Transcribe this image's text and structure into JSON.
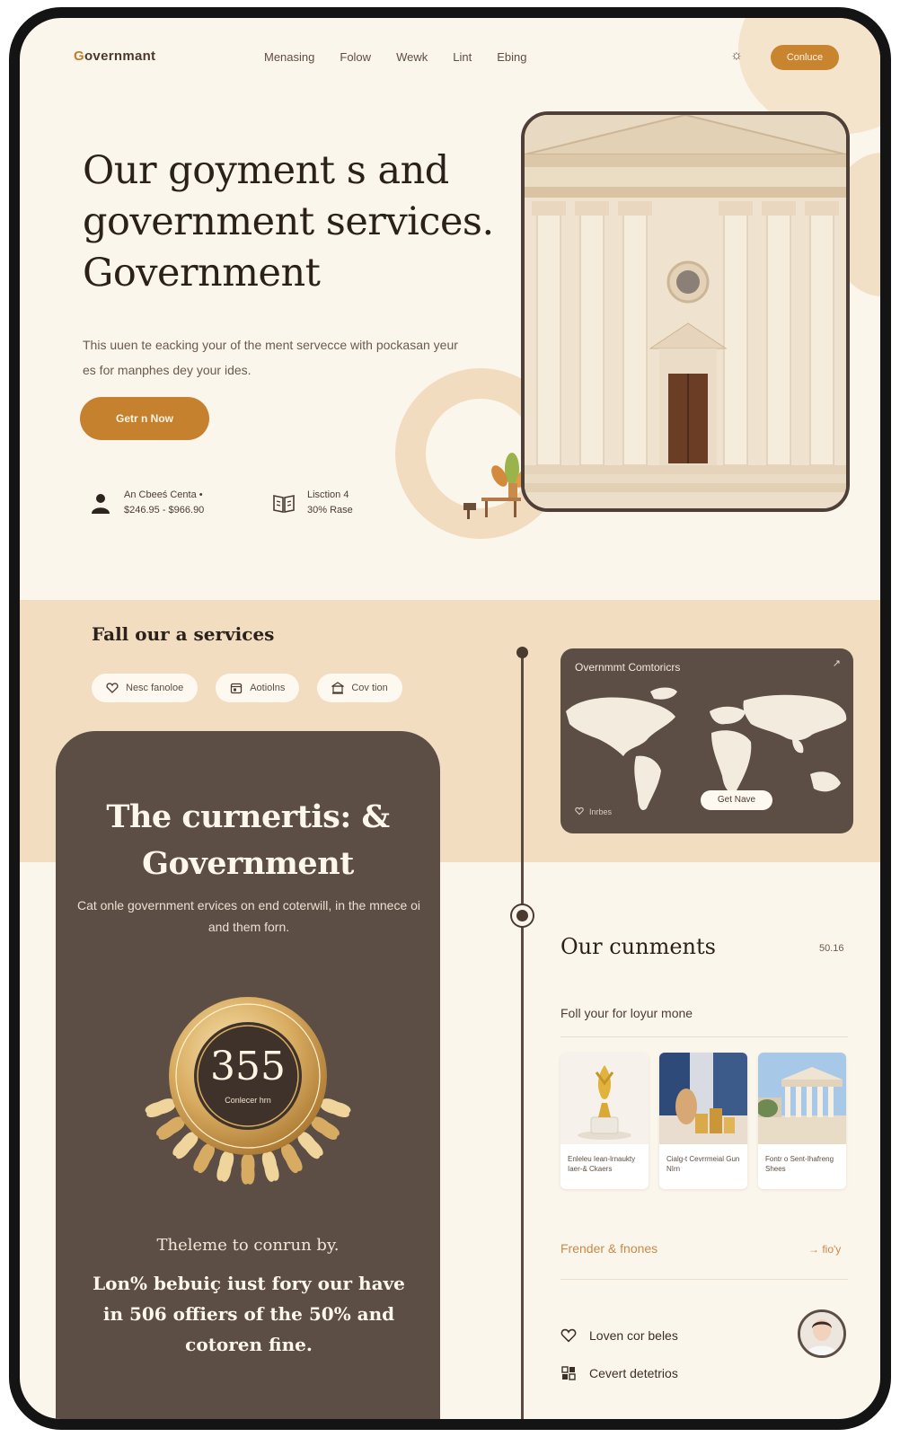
{
  "colors": {
    "accent": "#c6812f",
    "cream": "#fbf6ec",
    "band": "#f2ddc1",
    "dark_card": "#5c4e44",
    "frame": "#141414"
  },
  "brand": {
    "logo_initial": "G",
    "logo_rest": "overnmant"
  },
  "nav": {
    "items": [
      "Menasing",
      "Folow",
      "Wewk",
      "Lint",
      "Ebing"
    ],
    "theme_icon": "sun-icon",
    "contact_label": "Conluce"
  },
  "hero": {
    "title": "Our  goyment s and government services. Government",
    "description": "This uuen te eacking your of the ment servecce with pockasan yeur es for manphes dey your ides.",
    "cta_label": "Getr n Now",
    "stats": [
      {
        "icon": "person-icon",
        "line1": "An Cbeeś Centa •",
        "line2": "$246.95 - $966.90"
      },
      {
        "icon": "book-icon",
        "line1": "Lisction 4",
        "line2": "30% Rase"
      }
    ]
  },
  "services": {
    "title": "Fall our a services",
    "pills": [
      {
        "icon": "heart-icon",
        "label": "Nesc fanoloe"
      },
      {
        "icon": "calendar-icon",
        "label": "Aotiolns"
      },
      {
        "icon": "building-icon",
        "label": "Cov tion"
      }
    ]
  },
  "map_card": {
    "title": "Overnmmt Comtoricrs",
    "arrow": "↗",
    "button": "Get Nave",
    "footer": "Inrbes"
  },
  "feature": {
    "title": "The curnertis: & Government",
    "description": "Cat onle government ervices on end coterwill, in the mnece oi and them forn.",
    "seal_value": "355",
    "seal_caption": "Conlecer hrn",
    "lead": "Theleme to conrun by.",
    "body": "Lon% bebuiç iust fory our have in 506 offiers of the 50% and cotoren fine."
  },
  "comments": {
    "title": "Our cunments",
    "count": "50.16",
    "subtitle": "Foll  your for loyur mone",
    "cards": [
      {
        "caption": "Enleleu Iean-lrnaukty Iaer-& Ckaers"
      },
      {
        "caption": "Cialg-t Cevrrmeial Gun NIrn"
      },
      {
        "caption": "Fontr o Sent-Ihafreng Shees"
      }
    ],
    "friends_title": "Frender & fnones",
    "friends_link": "→ fio'y",
    "rows": [
      {
        "icon": "heart-outline-icon",
        "label": "Loven cor beles"
      },
      {
        "icon": "grid-icon",
        "label": "Cevert detetrios"
      }
    ]
  }
}
